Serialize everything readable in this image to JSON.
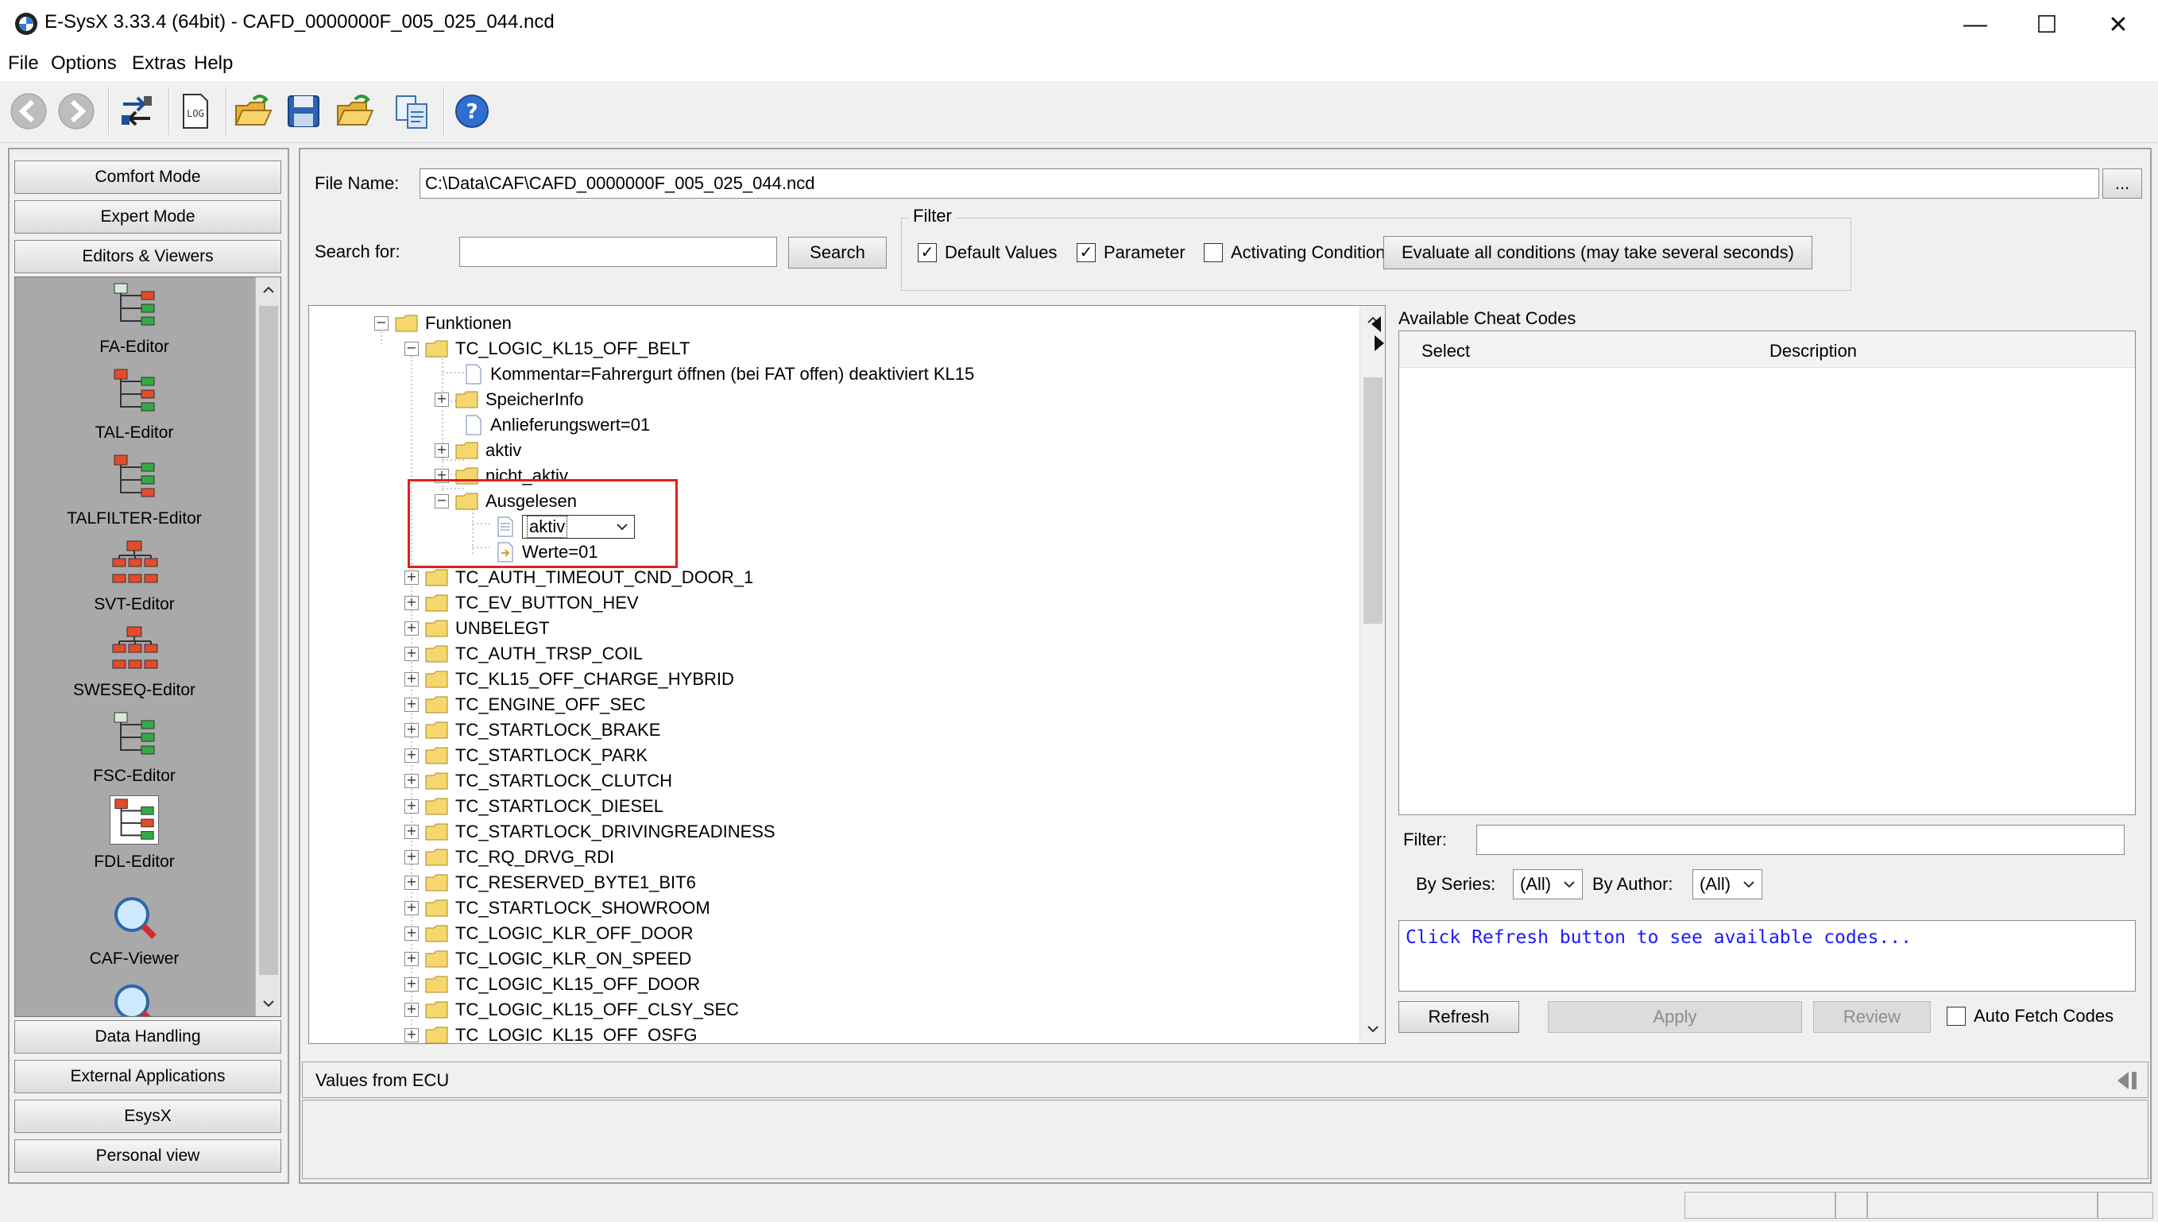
{
  "window": {
    "title": "E-SysX 3.33.4  (64bit) - CAFD_0000000F_005_025_044.ncd",
    "minimize": "—",
    "maximize": "☐",
    "close": "✕"
  },
  "menu": [
    "File",
    "Options",
    "Extras",
    "Help"
  ],
  "toolbar": {
    "icons": [
      "back-arrow-icon",
      "forward-arrow-icon",
      "connect-icon",
      "log-icon",
      "open-folder-icon",
      "save-disk-icon",
      "open-folder-icon",
      "copy-files-icon",
      "help-icon"
    ],
    "log_label": "LOG",
    "help_label": "?"
  },
  "left": {
    "top_buttons": [
      "Comfort Mode",
      "Expert Mode",
      "Editors & Viewers"
    ],
    "editors": [
      "FA-Editor",
      "TAL-Editor",
      "TALFILTER-Editor",
      "SVT-Editor",
      "SWESEQ-Editor",
      "FSC-Editor",
      "FDL-Editor",
      "CAF-Viewer"
    ],
    "bottom_buttons": [
      "Data Handling",
      "External Applications",
      "EsysX",
      "Personal view"
    ]
  },
  "file": {
    "label": "File Name:",
    "value": "C:\\Data\\CAF\\CAFD_0000000F_005_025_044.ncd",
    "browse": "..."
  },
  "search": {
    "label": "Search for:",
    "value": "",
    "button": "Search"
  },
  "filter": {
    "title": "Filter",
    "default_values": "Default Values",
    "parameter": "Parameter",
    "activating_condition": "Activating Condition",
    "evaluate": "Evaluate all conditions (may take several seconds)"
  },
  "tree": {
    "root": "Funktionen",
    "belt": "TC_LOGIC_KL15_OFF_BELT",
    "kommentar": "Kommentar=Fahrergurt öffnen (bei FAT offen) deaktiviert KL15",
    "speicher": "SpeicherInfo",
    "anlieferung": "Anlieferungswert=01",
    "aktiv": "aktiv",
    "nicht_aktiv": "nicht_aktiv",
    "ausgelesen": "Ausgelesen",
    "edit_value": "aktiv",
    "werte": "Werte=01",
    "others": [
      "TC_AUTH_TIMEOUT_CND_DOOR_1",
      "TC_EV_BUTTON_HEV",
      "UNBELEGT",
      "TC_AUTH_TRSP_COIL",
      "TC_KL15_OFF_CHARGE_HYBRID",
      "TC_ENGINE_OFF_SEC",
      "TC_STARTLOCK_BRAKE",
      "TC_STARTLOCK_PARK",
      "TC_STARTLOCK_CLUTCH",
      "TC_STARTLOCK_DIESEL",
      "TC_STARTLOCK_DRIVINGREADINESS",
      "TC_RQ_DRVG_RDI",
      "TC_RESERVED_BYTE1_BIT6",
      "TC_STARTLOCK_SHOWROOM",
      "TC_LOGIC_KLR_OFF_DOOR",
      "TC_LOGIC_KLR_ON_SPEED",
      "TC_LOGIC_KL15_OFF_DOOR",
      "TC_LOGIC_KL15_OFF_CLSY_SEC",
      "TC_LOGIC_KL15_OFF_OSFG"
    ]
  },
  "cheat": {
    "title": "Available Cheat Codes",
    "col_select": "Select",
    "col_description": "Description",
    "filter_label": "Filter:",
    "by_series": "By Series:",
    "series_value": "(All)",
    "by_author": "By Author:",
    "author_value": "(All)",
    "message": "Click Refresh button to see available codes...",
    "refresh": "Refresh",
    "apply": "Apply",
    "review": "Review",
    "auto_fetch": "Auto Fetch Codes"
  },
  "values": {
    "title": "Values from ECU"
  },
  "colors": {
    "highlight": "#e01e1e",
    "message": "#1a1aff",
    "folder": "#f5d76e",
    "editor_bg": "#a9a9a9"
  }
}
